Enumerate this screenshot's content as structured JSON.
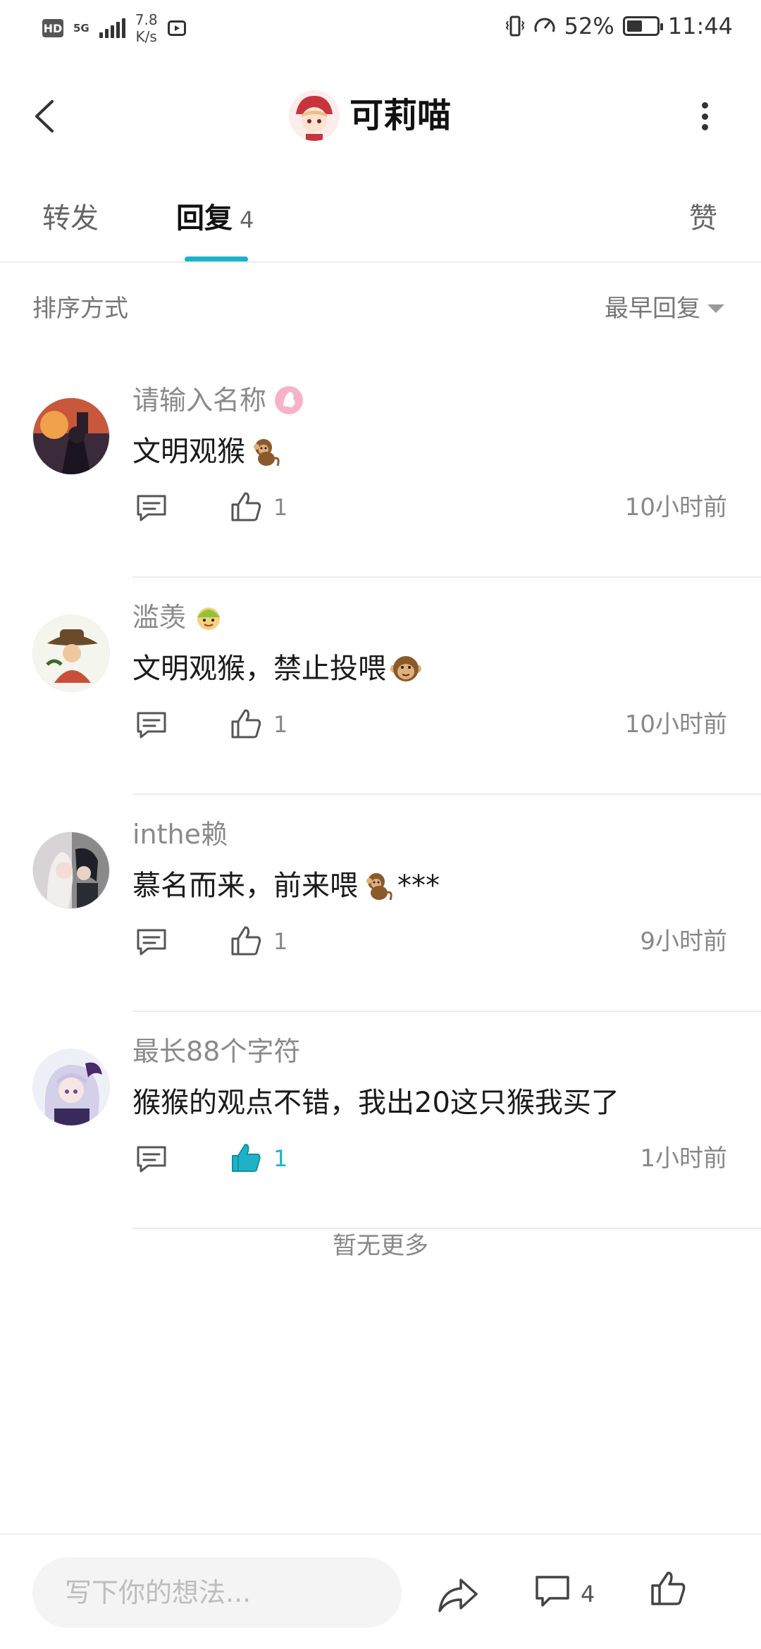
{
  "status_bar": {
    "hd_label": "HD",
    "network": "5G",
    "speed_value": "7.8",
    "speed_unit": "K/s",
    "battery": "52%",
    "battery_level": 0.52,
    "time": "11:44"
  },
  "header": {
    "title": "可莉喵",
    "back_icon": "chevron-left-icon",
    "more_icon": "more-vertical-icon"
  },
  "tabs": [
    {
      "label": "转发"
    },
    {
      "label": "回复",
      "count": "4",
      "active": true
    },
    {
      "label": "赞"
    }
  ],
  "sort": {
    "label": "排序方式",
    "value": "最早回复"
  },
  "comments": [
    {
      "name": "请输入名称",
      "badge": "pink-badge-icon",
      "text": "文明观猴",
      "emoji": "monkey-emoji",
      "likes": "1",
      "liked": false,
      "time": "10小时前"
    },
    {
      "name": "滥羡",
      "badge": "cartoon-face-badge-icon",
      "text": "文明观猴，禁止投喂",
      "emoji": "monkey-face-emoji",
      "likes": "1",
      "liked": false,
      "time": "10小时前"
    },
    {
      "name": "inthe赖",
      "text": "慕名而来，前来喂",
      "emoji": "monkey-emoji",
      "text_suffix": "***",
      "likes": "1",
      "liked": false,
      "time": "9小时前"
    },
    {
      "name": "最长88个字符",
      "text": "猴猴的观点不错，我出20这只猴我买了",
      "likes": "1",
      "liked": true,
      "time": "1小时前"
    }
  ],
  "footer_note": "暂无更多",
  "bottom_bar": {
    "input_placeholder": "写下你的想法...",
    "comment_count": "4"
  },
  "colors": {
    "accent": "#1eb2c8",
    "text_secondary": "#888888"
  }
}
